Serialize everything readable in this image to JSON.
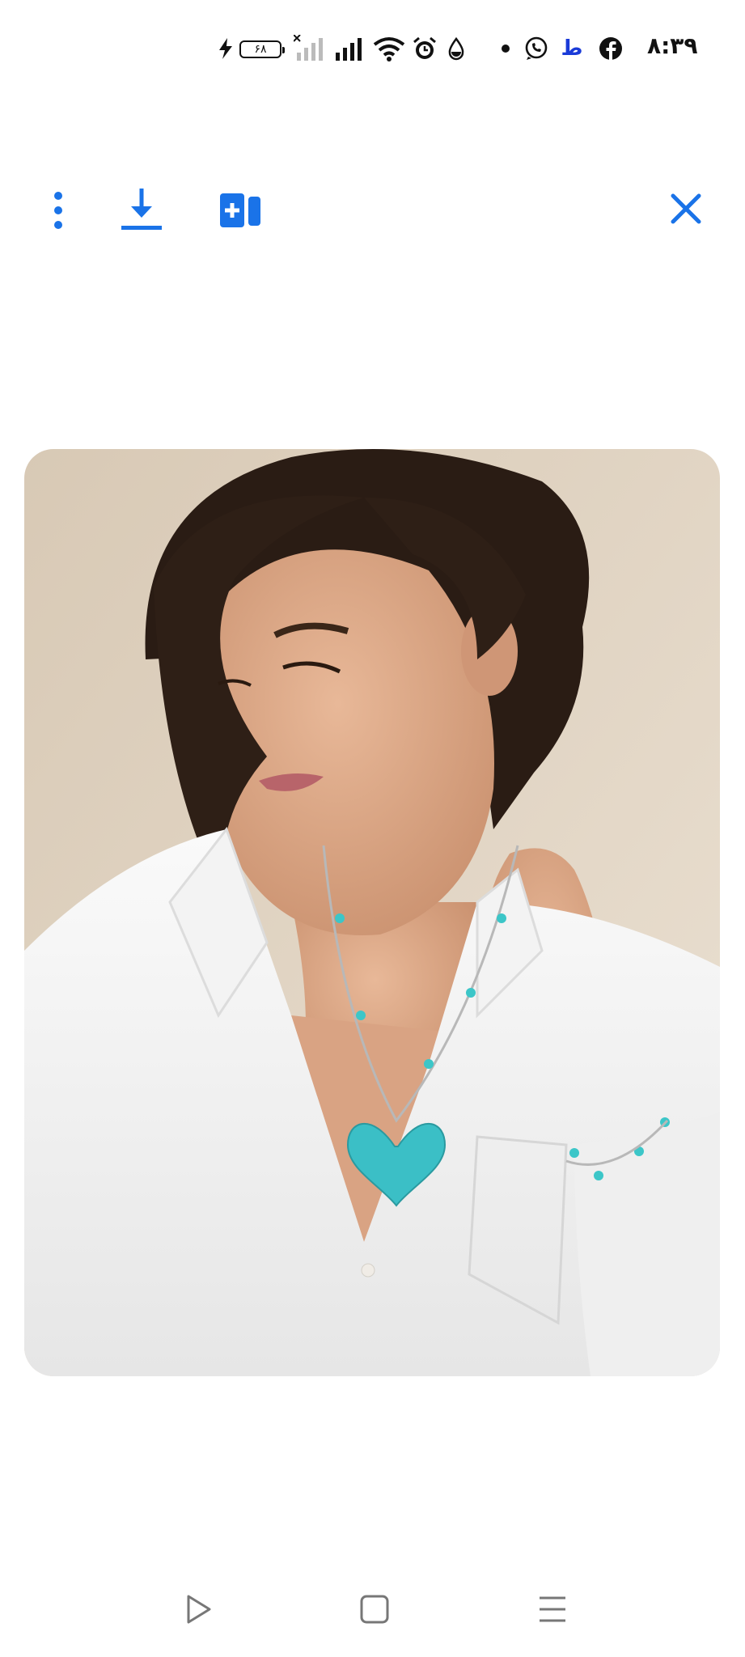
{
  "status_bar": {
    "time": "۸:۳۹",
    "battery_level": "۶۸",
    "notification_letter": "ط",
    "icons": [
      "flash-icon",
      "battery-icon",
      "no-signal-icon",
      "signal-icon",
      "wifi-icon",
      "alarm-icon",
      "drop-icon",
      "dot-icon",
      "whatsapp-icon",
      "bank-app-icon",
      "facebook-icon"
    ]
  },
  "toolbar": {
    "icons": [
      "more-vert-icon",
      "download-icon",
      "add-to-collection-icon",
      "close-icon"
    ],
    "accent_color": "#1a73e8"
  },
  "photo": {
    "description_icon": "portrait-image"
  },
  "nav": {
    "icons": [
      "back-triangle-icon",
      "home-square-icon",
      "recents-menu-icon"
    ]
  }
}
